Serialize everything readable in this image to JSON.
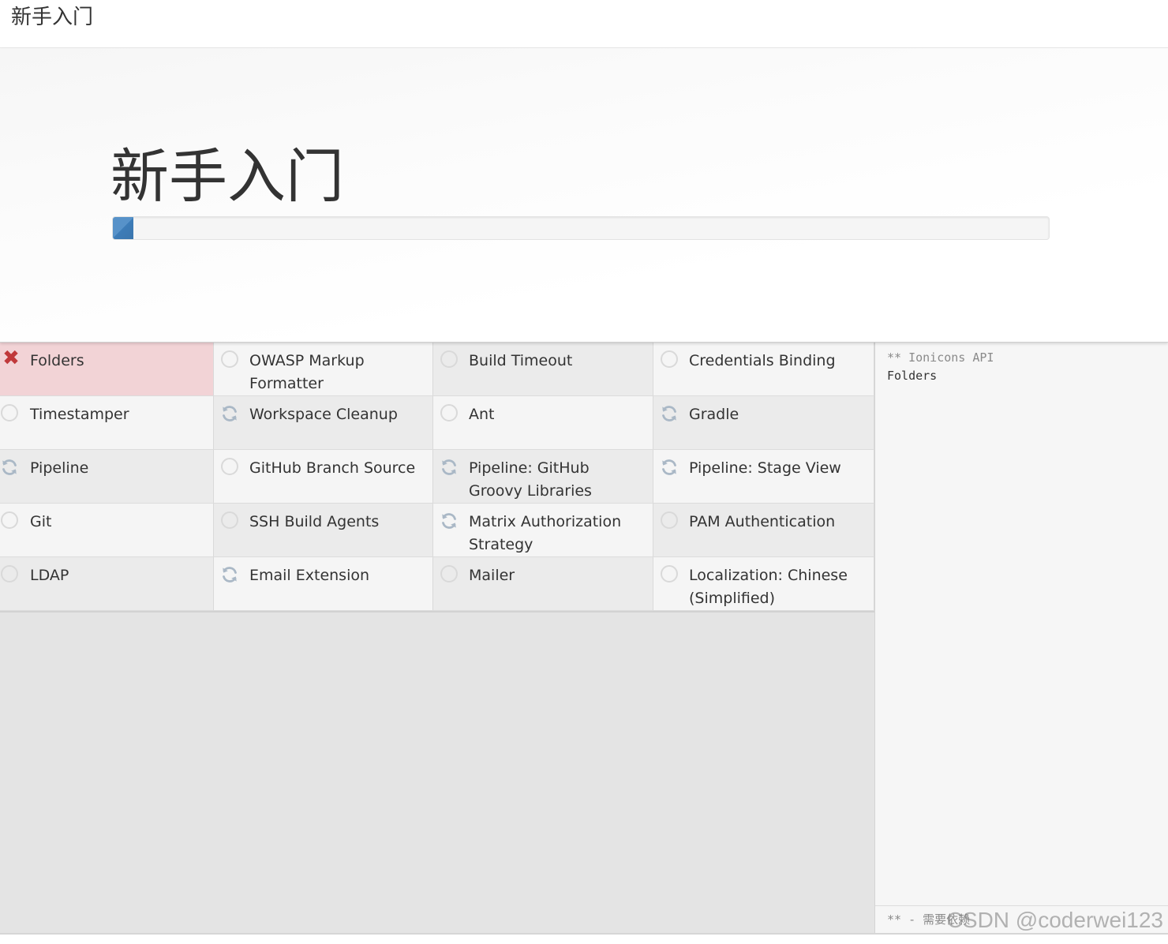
{
  "topbar": {
    "title": "新手入门"
  },
  "hero": {
    "title": "新手入门",
    "progress_fraction": 0.022
  },
  "colors": {
    "progress": "#5792c9",
    "failed_bg": "#f2d3d6",
    "failed_icon": "#c0393b",
    "pending_icon": "#d9d9d9",
    "installing_icon": "#aab8c6"
  },
  "plugins": [
    {
      "name": "Folders",
      "status": "failed",
      "icon": "x-icon"
    },
    {
      "name": "OWASP Markup Formatter",
      "status": "pending",
      "icon": "circle-icon"
    },
    {
      "name": "Build Timeout",
      "status": "pending",
      "icon": "circle-icon"
    },
    {
      "name": "Credentials Binding",
      "status": "pending",
      "icon": "circle-icon"
    },
    {
      "name": "Timestamper",
      "status": "pending",
      "icon": "circle-icon"
    },
    {
      "name": "Workspace Cleanup",
      "status": "installing",
      "icon": "refresh-icon"
    },
    {
      "name": "Ant",
      "status": "pending",
      "icon": "circle-icon"
    },
    {
      "name": "Gradle",
      "status": "installing",
      "icon": "refresh-icon"
    },
    {
      "name": "Pipeline",
      "status": "installing",
      "icon": "refresh-icon"
    },
    {
      "name": "GitHub Branch Source",
      "status": "pending",
      "icon": "circle-icon"
    },
    {
      "name": "Pipeline: GitHub Groovy Libraries",
      "status": "installing",
      "icon": "refresh-icon"
    },
    {
      "name": "Pipeline: Stage View",
      "status": "installing",
      "icon": "refresh-icon"
    },
    {
      "name": "Git",
      "status": "pending",
      "icon": "circle-icon"
    },
    {
      "name": "SSH Build Agents",
      "status": "pending",
      "icon": "circle-icon"
    },
    {
      "name": "Matrix Authorization Strategy",
      "status": "installing",
      "icon": "refresh-icon"
    },
    {
      "name": "PAM Authentication",
      "status": "pending",
      "icon": "circle-icon"
    },
    {
      "name": "LDAP",
      "status": "pending",
      "icon": "circle-icon"
    },
    {
      "name": "Email Extension",
      "status": "installing",
      "icon": "refresh-icon"
    },
    {
      "name": "Mailer",
      "status": "pending",
      "icon": "circle-icon"
    },
    {
      "name": "Localization: Chinese (Simplified)",
      "status": "pending",
      "icon": "circle-icon"
    }
  ],
  "log": {
    "lines": [
      "** Ionicons API",
      "Folders"
    ],
    "footer": "** - 需要依赖"
  },
  "watermark": "CSDN @coderwei123"
}
